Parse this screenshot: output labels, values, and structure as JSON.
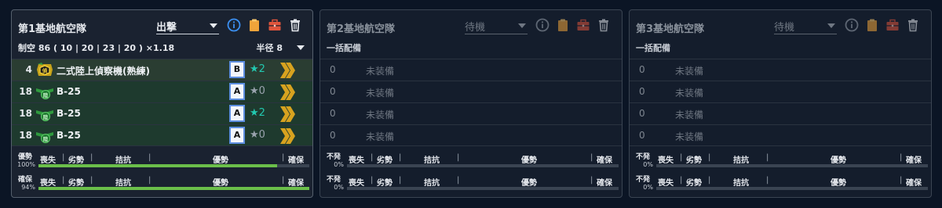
{
  "panels": [
    {
      "title": "第1基地航空隊",
      "status": "出撃",
      "air_power": "制空 86 ( 10 | 20 | 23 | 20 ) ×1.18",
      "radius": "半径 8",
      "slots": [
        {
          "count": "4",
          "name": "二式陸上偵察機(熟練)",
          "proficiency": "B",
          "star": "★2",
          "star_color": "teal",
          "icon": "recon-icon"
        },
        {
          "count": "18",
          "name": "B-25",
          "proficiency": "A",
          "star": "★0",
          "star_color": "gray",
          "icon": "land-bomber-icon"
        },
        {
          "count": "18",
          "name": "B-25",
          "proficiency": "A",
          "star": "★2",
          "star_color": "teal",
          "icon": "land-bomber-icon"
        },
        {
          "count": "18",
          "name": "B-25",
          "proficiency": "A",
          "star": "★0",
          "star_color": "gray",
          "icon": "land-bomber-icon"
        }
      ],
      "bars": [
        {
          "label": "優勢",
          "pct": "100%",
          "fill": 0.88
        },
        {
          "label": "確保",
          "pct": "94%",
          "fill": 1.0
        }
      ]
    },
    {
      "title": "第2基地航空隊",
      "status": "待機",
      "mass_assign": "一括配備",
      "slots": [
        {
          "count": "0",
          "name": "未装備"
        },
        {
          "count": "0",
          "name": "未装備"
        },
        {
          "count": "0",
          "name": "未装備"
        },
        {
          "count": "0",
          "name": "未装備"
        }
      ],
      "bars": [
        {
          "label": "不発",
          "pct": "0%",
          "fill": 0
        },
        {
          "label": "不発",
          "pct": "0%",
          "fill": 0
        }
      ]
    },
    {
      "title": "第3基地航空隊",
      "status": "待機",
      "mass_assign": "一括配備",
      "slots": [
        {
          "count": "0",
          "name": "未装備"
        },
        {
          "count": "0",
          "name": "未装備"
        },
        {
          "count": "0",
          "name": "未装備"
        },
        {
          "count": "0",
          "name": "未装備"
        }
      ],
      "bars": [
        {
          "label": "不発",
          "pct": "0%",
          "fill": 0
        },
        {
          "label": "不発",
          "pct": "0%",
          "fill": 0
        }
      ]
    }
  ],
  "bar_segments": [
    "喪失",
    "劣勢",
    "拮抗",
    "優勢",
    "確保"
  ],
  "icons": {
    "info": "info-icon",
    "clipboard": "clipboard-icon",
    "toolbox": "toolbox-icon",
    "trash": "trash-icon"
  },
  "colors": {
    "active_bg": "#1a2230",
    "slot_green": "#1e3a2e",
    "bar_fill": "#6bbf4a",
    "teal_star": "#22c9b0",
    "prof_border": "#5d8ee0",
    "rank_gold": "#d7a21f"
  }
}
